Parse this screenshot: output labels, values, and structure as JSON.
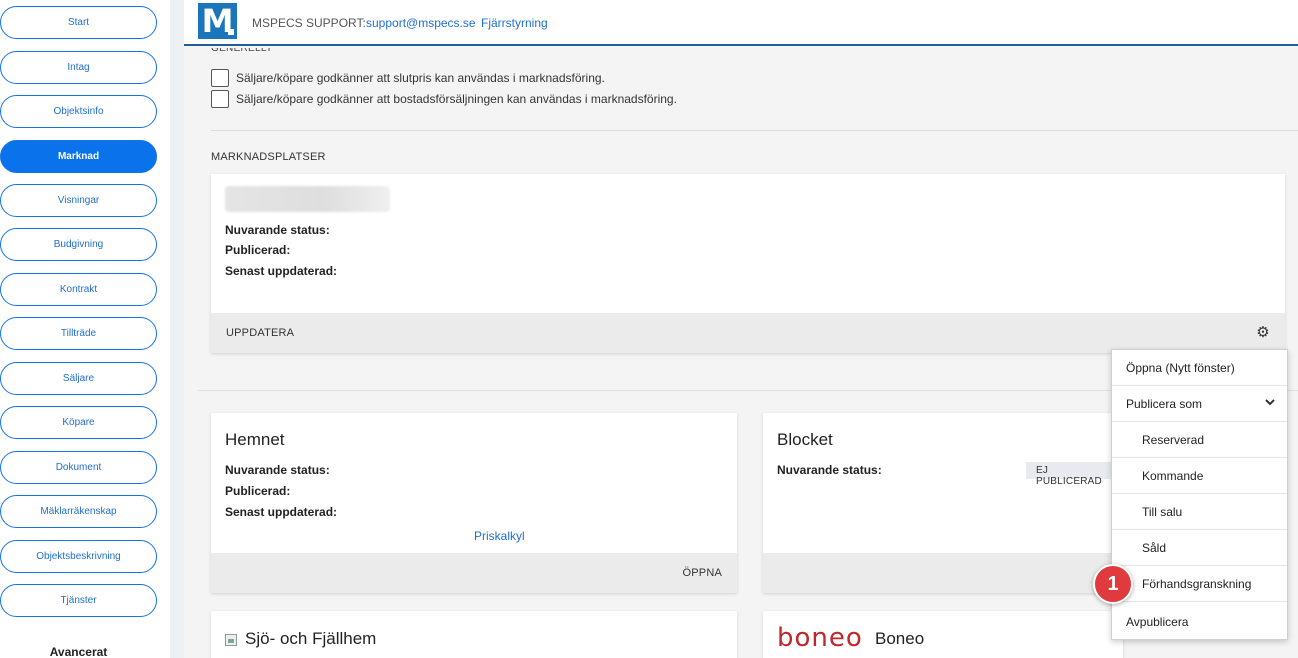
{
  "sidebar": {
    "items": [
      {
        "label": "Start",
        "active": false
      },
      {
        "label": "Intag",
        "active": false
      },
      {
        "label": "Objektsinfo",
        "active": false
      },
      {
        "label": "Marknad",
        "active": true
      },
      {
        "label": "Visningar",
        "active": false
      },
      {
        "label": "Budgivning",
        "active": false
      },
      {
        "label": "Kontrakt",
        "active": false
      },
      {
        "label": "Tillträde",
        "active": false
      },
      {
        "label": "Säljare",
        "active": false
      },
      {
        "label": "Köpare",
        "active": false
      },
      {
        "label": "Dokument",
        "active": false
      },
      {
        "label": "Mäklarräkenskap",
        "active": false
      },
      {
        "label": "Objektsbeskrivning",
        "active": false
      },
      {
        "label": "Tjänster",
        "active": false
      }
    ],
    "advanced_heading": "Avancerat"
  },
  "header": {
    "logo_letter": "M",
    "support_label": "MSPECS SUPPORT:",
    "support_email": "support@mspecs.se",
    "remote_link": "Fjärrstyrning"
  },
  "general": {
    "section_label": "GENERELLT",
    "checkbox_1": "Säljare/köpare godkänner att slutpris kan användas i marknadsföring.",
    "checkbox_2": "Säljare/köpare godkänner att bostadsförsäljningen kan användas i marknadsföring."
  },
  "marketplaces": {
    "heading": "MARKNADSPLATSER",
    "main_card": {
      "current_status": "Nuvarande status:",
      "published": "Publicerad:",
      "last_updated": "Senast uppdaterad:",
      "footer_action": "UPPDATERA"
    },
    "hemnet": {
      "title": "Hemnet",
      "current_status": "Nuvarande status:",
      "published": "Publicerad:",
      "last_updated": "Senast uppdaterad:",
      "price_link": "Priskalkyl",
      "footer_action": "ÖPPNA"
    },
    "blocket": {
      "title": "Blocket",
      "current_status": "Nuvarande status:",
      "status_value": "EJ PUBLICERAD"
    },
    "sjo_fjallhem": {
      "title": "Sjö- och Fjällhem"
    },
    "boneo": {
      "logo_text": "boneo",
      "title": "Boneo"
    }
  },
  "dropdown": {
    "open_new_window": "Öppna  (Nytt fönster)",
    "publish_as": "Publicera som",
    "sub_items": [
      "Reserverad",
      "Kommande",
      "Till salu",
      "Såld",
      "Förhandsgranskning"
    ],
    "unpublish": "Avpublicera"
  },
  "annotation": {
    "badge_number": "1"
  },
  "icons": {
    "gear": "gear-icon",
    "chevron": "chevron-down-icon",
    "broken_image": "broken-image-icon"
  },
  "colors": {
    "accent_blue": "#0a73eb",
    "link_blue": "#1f6fd0",
    "badge_red": "#e0393e",
    "header_border": "#1e5f96",
    "boneo_red": "#c0282e"
  }
}
